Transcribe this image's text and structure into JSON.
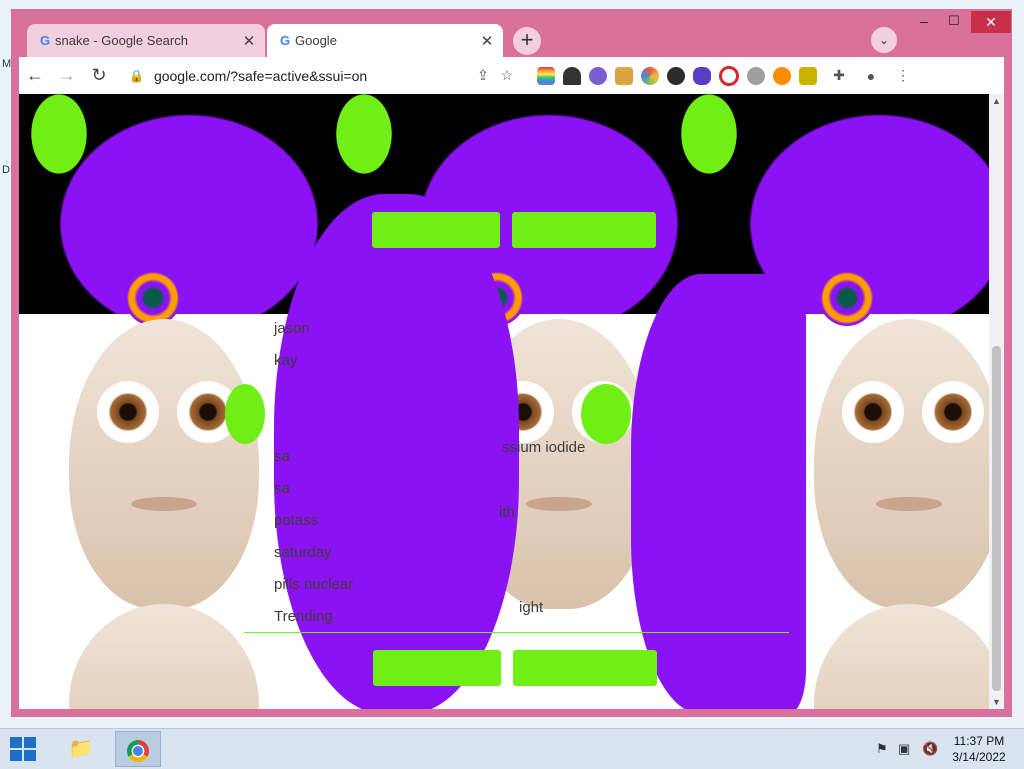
{
  "desktop": {
    "edge_letters": [
      "M",
      "D"
    ]
  },
  "browser": {
    "tabs": [
      {
        "title": "snake - Google Search",
        "favicon": "google-g-icon",
        "active": false
      },
      {
        "title": "Google",
        "favicon": "google-g-icon",
        "active": true
      }
    ],
    "new_tab_symbol": "+",
    "tab_search_symbol": "⌄",
    "window_controls": {
      "minimize": "–",
      "maximize": "☐",
      "close": "✕"
    },
    "address": "google.com/?safe=active&ssui=on",
    "nav": {
      "back": "←",
      "forward": "→",
      "reload": "↻"
    },
    "toolbar_icons": [
      "share-icon",
      "star-icon",
      "puzzle-extensions-icon",
      "profile-icon",
      "menu-kebab-icon"
    ],
    "extensions": [
      {
        "name": "rainbow-flag-extension-icon",
        "color": "#8a2be2"
      },
      {
        "name": "hat-extension-icon",
        "color": "#333333"
      },
      {
        "name": "cat-extension-icon",
        "color": "#7b5fd1"
      },
      {
        "name": "doge-extension-icon",
        "color": "#d9a441"
      },
      {
        "name": "color-wheel-extension-icon",
        "color": "#e9573f"
      },
      {
        "name": "compass-extension-icon",
        "color": "#2b2b2b"
      },
      {
        "name": "splat-extension-icon",
        "color": "#5a3ec8"
      },
      {
        "name": "block-extension-icon",
        "color": "#d62828"
      },
      {
        "name": "koala-extension-icon",
        "color": "#9e9e9e"
      },
      {
        "name": "sun-extension-icon",
        "color": "#ff8c00"
      },
      {
        "name": "bird-extension-icon",
        "color": "#c9b300"
      }
    ]
  },
  "page": {
    "suggestions": [
      "jason",
      "kay",
      "",
      "",
      "sa",
      "sa",
      "potass",
      "saturday",
      "pills nuclear",
      "Trending"
    ],
    "fragments": [
      "ssium iodide",
      "ith",
      "ight"
    ]
  },
  "taskbar": {
    "apps": [
      "file-explorer-icon",
      "chrome-icon"
    ],
    "tray": [
      "flag-icon",
      "network-icon",
      "volume-muted-icon"
    ],
    "time": "11:37 PM",
    "date": "3/14/2022"
  }
}
